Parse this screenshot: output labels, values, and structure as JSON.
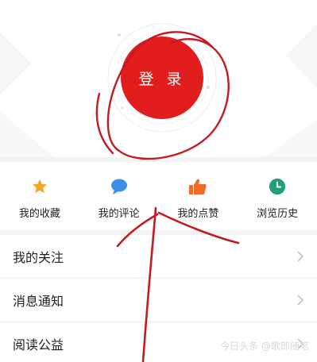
{
  "login": {
    "label": "登 录"
  },
  "shortcuts": [
    {
      "label": "我的收藏",
      "icon": "star-icon",
      "color": "#f5a623"
    },
    {
      "label": "我的评论",
      "icon": "comment-icon",
      "color": "#3a8ee6"
    },
    {
      "label": "我的点赞",
      "icon": "thumbs-up-icon",
      "color": "#f06a2a"
    },
    {
      "label": "浏览历史",
      "icon": "clock-icon",
      "color": "#1f9e77"
    }
  ],
  "menu": [
    {
      "label": "我的关注",
      "icon": "chevron-right-icon"
    },
    {
      "label": "消息通知",
      "icon": "chevron-right-icon"
    },
    {
      "label": "阅读公益",
      "icon": "chevron-right-icon"
    }
  ],
  "watermark": "今日头条 @歌郎随笔",
  "colors": {
    "accent": "#e11d1d",
    "annotation": "#c41a24"
  }
}
